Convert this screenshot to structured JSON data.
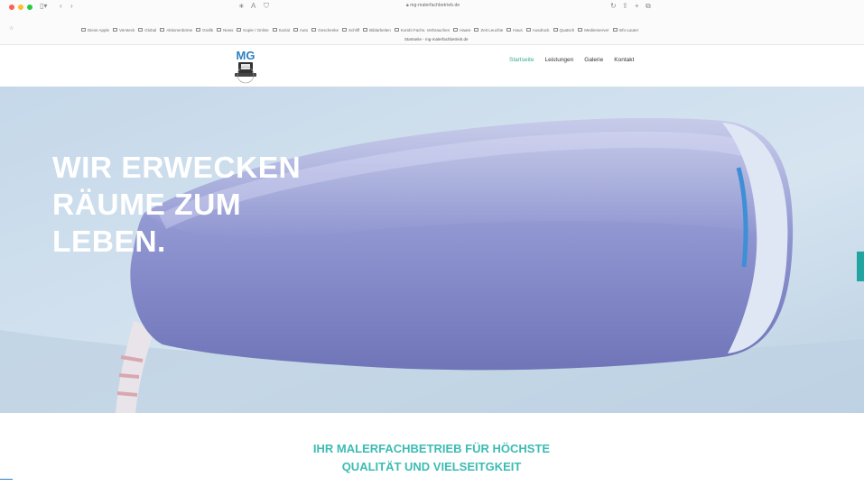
{
  "browser": {
    "url": "mg-malerfachbetrieb.de",
    "tab_title": "Startseite - mg-malerfachbetrieb.de",
    "bookmarks": [
      "Diese Apple",
      "Versteck",
      "Global",
      "Aktionenbörse",
      "Grafik",
      "News",
      "Kopie / Online",
      "Sozial",
      "Auto",
      "Geschenke",
      "Schliff",
      "Bildarbeiten",
      "Kombi Fachs. Verbrauchen",
      "Haare",
      "Zeit Leuchte",
      "Haus",
      "Ausdruck",
      "Quatsch",
      "Medienserver",
      "Info-Lauter"
    ]
  },
  "site": {
    "logo_text": "MG",
    "nav": [
      "Startseite",
      "Leistungen",
      "Galerie",
      "Kontakt"
    ]
  },
  "hero": {
    "title_lines": [
      "WIR ERWECKEN",
      "RÄUME ZUM",
      "LEBEN."
    ]
  },
  "content": {
    "tagline_lines": [
      "IHR MALERFACHBETRIEB FÜR HÖCHSTE",
      "QUALITÄT UND VIELSEITGKEIT"
    ]
  },
  "colors": {
    "accent": "#3aaa95",
    "tagline": "#3cbcb3",
    "side_tab": "#22a5a0",
    "hero_text": "#ffffff"
  }
}
